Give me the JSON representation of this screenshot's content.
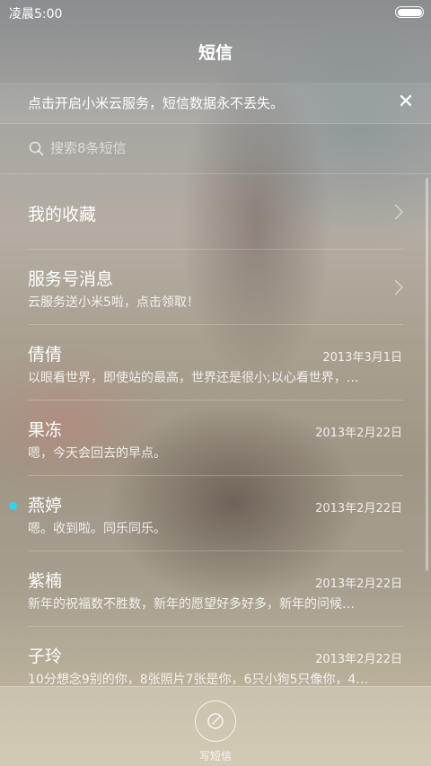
{
  "status_bar": {
    "time": "凌晨5:00"
  },
  "header": {
    "title": "短信"
  },
  "notice": {
    "text": "点击开启小米云服务，短信数据永不丢失。",
    "close_symbol": "✕"
  },
  "search": {
    "placeholder": "搜索8条短信"
  },
  "list": {
    "items": [
      {
        "name": "我的收藏",
        "preview": "",
        "date": ""
      },
      {
        "name": "服务号消息",
        "preview": "云服务送小米5啦，点击领取！",
        "date": ""
      },
      {
        "name": "倩倩",
        "preview": "以眼看世界，即使站的最高，世界还是很小;以心看世界，…",
        "date": "2013年3月1日"
      },
      {
        "name": "果冻",
        "preview": "嗯，今天会回去的早点。",
        "date": "2013年2月22日"
      },
      {
        "name": "燕婷",
        "preview": "嗯。收到啦。同乐同乐。",
        "date": "2013年2月22日",
        "unread": true
      },
      {
        "name": "紫楠",
        "preview": "新年的祝福数不胜数，新年的愿望好多好多，新年的问候…",
        "date": "2013年2月22日"
      },
      {
        "name": "子玲",
        "preview": "10分想念9别的你，8张照片7张是你，6只小狗5只像你，4…",
        "date": "2013年2月22日"
      }
    ]
  },
  "bottom": {
    "compose_label": "写短信"
  },
  "colors": {
    "unread_dot": "#32d2f0"
  }
}
